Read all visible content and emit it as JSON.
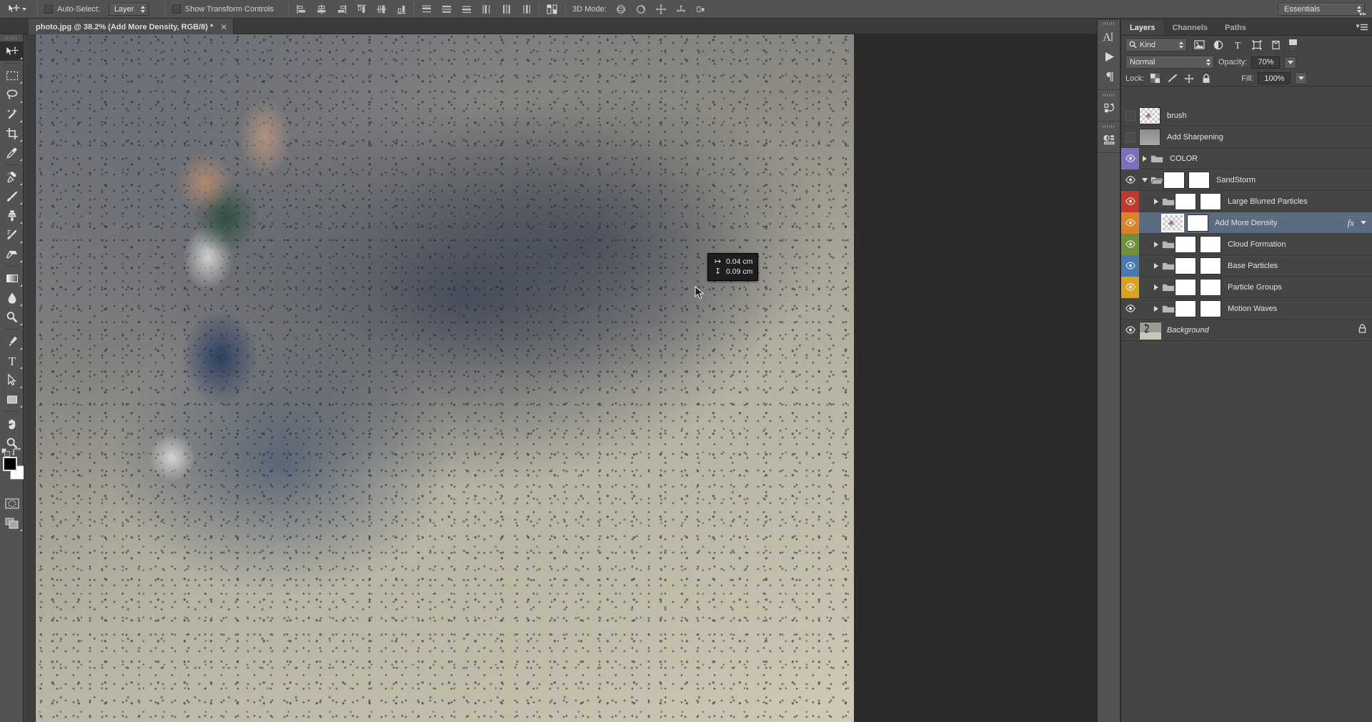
{
  "options_bar": {
    "tool_icon": "move-tool-icon",
    "auto_select_label": "Auto-Select:",
    "auto_select_value": "Layer",
    "auto_select_checked": false,
    "show_transform_label": "Show Transform Controls",
    "show_transform_checked": false,
    "align_icons": [
      "align-left-edges-icon",
      "align-horizontal-centers-icon",
      "align-right-edges-icon",
      "align-top-edges-icon",
      "align-vertical-centers-icon",
      "align-bottom-edges-icon"
    ],
    "distribute_icons": [
      "distribute-top-edges-icon",
      "distribute-vertical-centers-icon",
      "distribute-bottom-edges-icon",
      "distribute-left-edges-icon",
      "distribute-horizontal-centers-icon",
      "distribute-right-edges-icon"
    ],
    "auto_align_icon": "auto-align-layers-icon",
    "three_d_mode_label": "3D Mode:",
    "three_d_icons": [
      "3d-orbit-icon",
      "3d-roll-icon",
      "3d-pan-icon",
      "3d-slide-icon",
      "3d-scale-icon"
    ],
    "workspace": "Essentials"
  },
  "document": {
    "tab_title": "photo.jpg @ 38.2% (Add More Density, RGB/8) *",
    "close_icon": "close-icon",
    "zoom_percent": "38.2%",
    "color_mode": "RGB/8",
    "active_layer": "Add More Density",
    "modified": true
  },
  "toolbar": {
    "tools": [
      {
        "name": "move-tool",
        "selected": true,
        "has_corner": true
      },
      {
        "name": "rectangular-marquee-tool",
        "selected": false,
        "has_corner": true
      },
      {
        "name": "lasso-tool",
        "selected": false,
        "has_corner": true
      },
      {
        "name": "quick-selection-tool",
        "selected": false,
        "has_corner": true
      },
      {
        "name": "crop-tool",
        "selected": false,
        "has_corner": true
      },
      {
        "name": "eyedropper-tool",
        "selected": false,
        "has_corner": true
      },
      {
        "name": "spot-healing-brush-tool",
        "selected": false,
        "has_corner": true
      },
      {
        "name": "brush-tool",
        "selected": false,
        "has_corner": true
      },
      {
        "name": "clone-stamp-tool",
        "selected": false,
        "has_corner": true
      },
      {
        "name": "history-brush-tool",
        "selected": false,
        "has_corner": true
      },
      {
        "name": "eraser-tool",
        "selected": false,
        "has_corner": true
      },
      {
        "name": "gradient-tool",
        "selected": false,
        "has_corner": true
      },
      {
        "name": "blur-tool",
        "selected": false,
        "has_corner": true
      },
      {
        "name": "dodge-tool",
        "selected": false,
        "has_corner": true
      },
      {
        "name": "pen-tool",
        "selected": false,
        "has_corner": true
      },
      {
        "name": "horizontal-type-tool",
        "selected": false,
        "has_corner": true
      },
      {
        "name": "path-selection-tool",
        "selected": false,
        "has_corner": true
      },
      {
        "name": "rectangle-shape-tool",
        "selected": false,
        "has_corner": true
      },
      {
        "name": "hand-tool",
        "selected": false,
        "has_corner": false
      },
      {
        "name": "zoom-tool",
        "selected": false,
        "has_corner": false
      }
    ],
    "foreground_color": "#000000",
    "background_color": "#ffffff",
    "quick_mask_icon": "quick-mask-icon",
    "screen_mode_icon": "screen-mode-icon"
  },
  "measure_tooltip": {
    "width_label": "0.04 cm",
    "height_label": "0.09 cm",
    "width_glyph": "width-measure-icon",
    "height_glyph": "height-measure-icon"
  },
  "dock_rail": {
    "icons": [
      "character-panel-icon",
      "timeline-panel-icon",
      "paragraph-panel-icon",
      "history-panel-icon",
      "adjustments-panel-icon"
    ],
    "collapse_icon": "collapse-panels-icon"
  },
  "layers_panel": {
    "tabs": [
      {
        "label": "Layers",
        "active": true
      },
      {
        "label": "Channels",
        "active": false
      },
      {
        "label": "Paths",
        "active": false
      }
    ],
    "menu_icon": "panel-menu-icon",
    "filter": {
      "kind_label": "Kind",
      "search_icon": "search-icon",
      "type_filters": [
        "filter-pixel-layers-icon",
        "filter-adjustment-layers-icon",
        "filter-type-layers-icon",
        "filter-shape-layers-icon",
        "filter-smart-object-icon"
      ],
      "toggle_icon": "filter-toggle-icon"
    },
    "blend_mode": "Normal",
    "opacity_label": "Opacity:",
    "opacity_value": "70%",
    "lock_label": "Lock:",
    "lock_icons": [
      "lock-transparent-pixels-icon",
      "lock-image-pixels-icon",
      "lock-position-icon",
      "lock-all-icon"
    ],
    "fill_label": "Fill:",
    "fill_value": "100%",
    "layers": [
      {
        "name": "brush",
        "visible": false,
        "color": null,
        "type": "pixel",
        "thumb": "checker",
        "indent": 0,
        "expandable": false,
        "has_fx": false,
        "selected": false,
        "locked": false,
        "italic": false,
        "has_mask": false
      },
      {
        "name": "Add Sharpening",
        "visible": false,
        "color": null,
        "type": "pixel",
        "thumb": "gray",
        "indent": 0,
        "expandable": false,
        "has_fx": false,
        "selected": false,
        "locked": false,
        "italic": false,
        "has_mask": false
      },
      {
        "name": "COLOR",
        "visible": true,
        "color": "#7b6fbe",
        "type": "group",
        "thumb": "none",
        "indent": 0,
        "expandable": true,
        "expanded": false,
        "has_fx": false,
        "selected": false,
        "locked": false,
        "italic": false,
        "has_mask": false
      },
      {
        "name": "SandStorm",
        "visible": true,
        "color": null,
        "type": "group",
        "thumb": "white",
        "indent": 0,
        "expandable": true,
        "expanded": true,
        "has_fx": false,
        "selected": false,
        "locked": false,
        "italic": false,
        "has_mask": true
      },
      {
        "name": "Large Blurred Particles",
        "visible": true,
        "color": "#c0392b",
        "type": "group",
        "thumb": "white",
        "indent": 1,
        "expandable": true,
        "expanded": false,
        "has_fx": false,
        "selected": false,
        "locked": false,
        "italic": false,
        "has_mask": true
      },
      {
        "name": "Add More Density",
        "visible": true,
        "color": "#d98324",
        "type": "pixel",
        "thumb": "checker",
        "indent": 1,
        "expandable": false,
        "has_fx": true,
        "selected": true,
        "locked": false,
        "italic": false,
        "has_mask": true
      },
      {
        "name": "Cloud Formation",
        "visible": true,
        "color": "#6f8f3a",
        "type": "group",
        "thumb": "white",
        "indent": 1,
        "expandable": true,
        "expanded": false,
        "has_fx": false,
        "selected": false,
        "locked": false,
        "italic": false,
        "has_mask": true
      },
      {
        "name": "Base Particles",
        "visible": true,
        "color": "#4a78ad",
        "type": "group",
        "thumb": "white",
        "indent": 1,
        "expandable": true,
        "expanded": false,
        "has_fx": false,
        "selected": false,
        "locked": false,
        "italic": false,
        "has_mask": true
      },
      {
        "name": "Particle Groups",
        "visible": true,
        "color": "#d9a321",
        "type": "group",
        "thumb": "white",
        "indent": 1,
        "expandable": true,
        "expanded": false,
        "has_fx": false,
        "selected": false,
        "locked": false,
        "italic": false,
        "has_mask": true
      },
      {
        "name": "Motion Waves",
        "visible": true,
        "color": null,
        "type": "group",
        "thumb": "white",
        "indent": 1,
        "expandable": true,
        "expanded": false,
        "has_fx": false,
        "selected": false,
        "locked": false,
        "italic": false,
        "has_mask": true
      },
      {
        "name": "Background",
        "visible": true,
        "color": null,
        "type": "pixel",
        "thumb": "photo",
        "indent": 0,
        "expandable": false,
        "has_fx": false,
        "selected": false,
        "locked": true,
        "italic": true,
        "has_mask": false
      }
    ],
    "lock_badge_icon": "layer-locked-icon",
    "fx_icon": "layer-effects-icon"
  },
  "colors": {
    "panel_bg": "#454545",
    "bar_bg": "#535353",
    "canvas_bg": "#2b2b2b",
    "selection_blue": "#5b6b80",
    "text": "#e2e2e2"
  }
}
